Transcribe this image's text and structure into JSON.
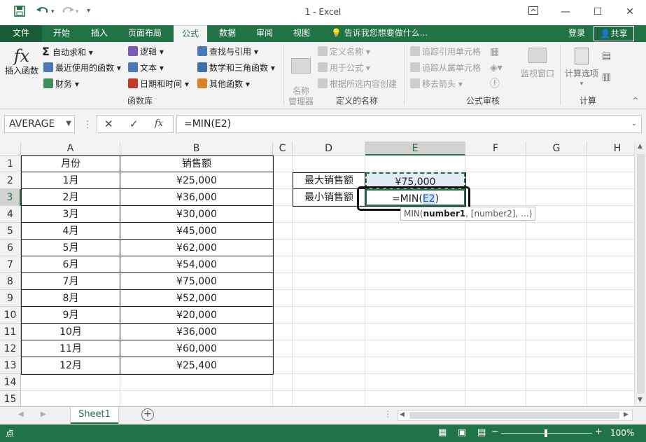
{
  "app": {
    "title": "1 - Excel"
  },
  "quick_access": {
    "save_icon": "save-icon",
    "undo_icon": "undo-icon",
    "redo_icon": "redo-icon"
  },
  "tabs": [
    "文件",
    "开始",
    "插入",
    "页面布局",
    "公式",
    "数据",
    "审阅",
    "视图"
  ],
  "active_tab": "公式",
  "tell_me": "告诉我您想要做什么...",
  "login": "登录",
  "share": "共享",
  "ribbon": {
    "insert_function": "插入函数",
    "autosum": "自动求和",
    "recent": "最近使用的函数",
    "financial": "财务",
    "logical": "逻辑",
    "text": "文本",
    "datetime": "日期和时间",
    "lookup": "查找与引用",
    "math": "数学和三角函数",
    "more": "其他函数",
    "group_library": "函数库",
    "name_manager": "名称\n管理器",
    "define_name": "定义名称",
    "use_in_formula": "用于公式",
    "create_from_selection": "根据所选内容创建",
    "group_names": "定义的名称",
    "trace_precedents": "追踪引用单元格",
    "trace_dependents": "追踪从属单元格",
    "remove_arrows": "移去箭头",
    "watch_window": "监视窗口",
    "group_audit": "公式审核",
    "calc_options": "计算选项",
    "group_calc": "计算"
  },
  "formula_bar": {
    "name_box": "AVERAGE",
    "formula": "=MIN(E2)"
  },
  "columns": [
    "A",
    "B",
    "C",
    "D",
    "E",
    "F",
    "G",
    "H"
  ],
  "rows": [
    "1",
    "2",
    "3",
    "4",
    "5",
    "6",
    "7",
    "8",
    "9",
    "10",
    "11",
    "12",
    "13",
    "14",
    "15"
  ],
  "table": {
    "headers": [
      "月份",
      "销售额"
    ],
    "rows": [
      [
        "1月",
        "¥25,000"
      ],
      [
        "2月",
        "¥36,000"
      ],
      [
        "3月",
        "¥30,000"
      ],
      [
        "4月",
        "¥45,000"
      ],
      [
        "5月",
        "¥62,000"
      ],
      [
        "6月",
        "¥54,000"
      ],
      [
        "7月",
        "¥75,000"
      ],
      [
        "8月",
        "¥52,000"
      ],
      [
        "9月",
        "¥20,000"
      ],
      [
        "10月",
        "¥36,000"
      ],
      [
        "11月",
        "¥60,000"
      ],
      [
        "12月",
        "¥25,400"
      ]
    ]
  },
  "summary": {
    "max_label": "最大销售额",
    "max_value": "¥75,000",
    "min_label": "最小销售额",
    "min_formula_prefix": "=MIN(",
    "min_formula_ref": "E2",
    "min_formula_suffix": ")"
  },
  "tooltip": {
    "fn": "MIN(",
    "arg1": "number1",
    "rest": ", [number2], ...)"
  },
  "sheet_tab": "Sheet1",
  "status": {
    "mode": "点",
    "zoom": "100%"
  },
  "colors": {
    "accent": "#217346",
    "ref_highlight": "#cfe0f5"
  }
}
